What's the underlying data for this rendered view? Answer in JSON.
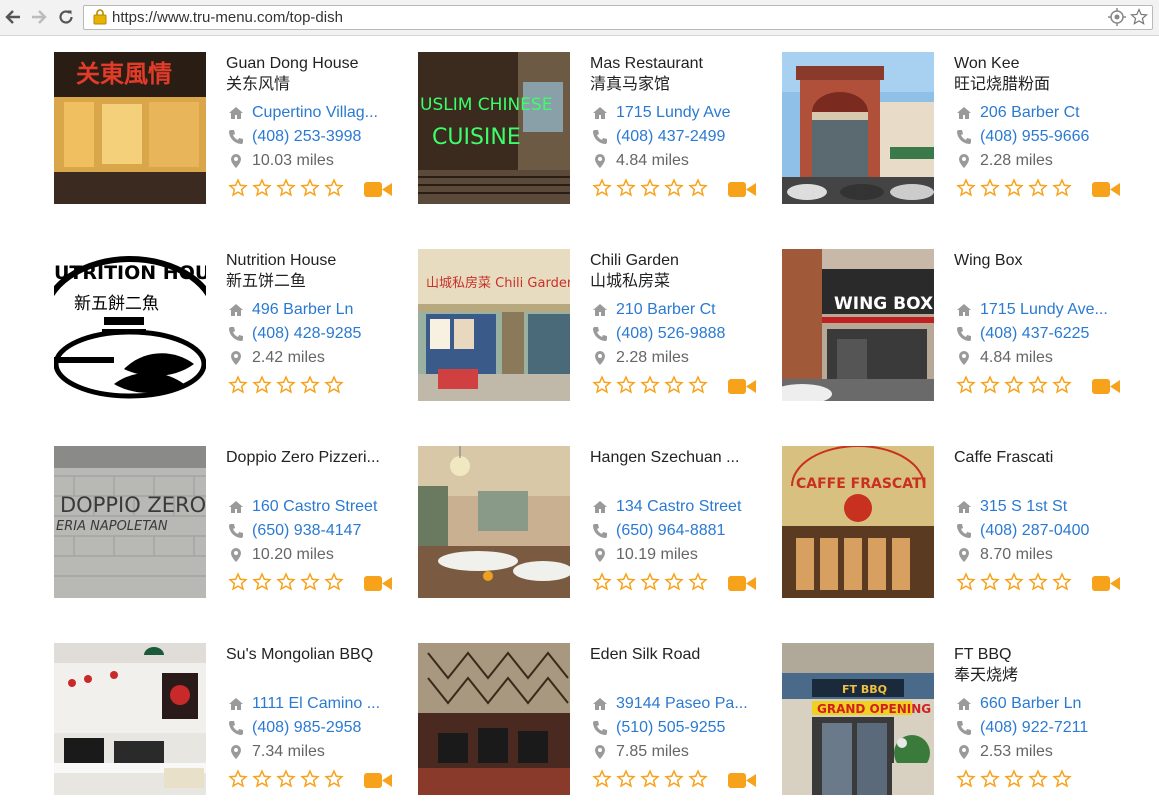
{
  "browser": {
    "url": "https://www.tru-menu.com/top-dish"
  },
  "colors": {
    "link": "#2a7ad2",
    "star": "#f7a21b",
    "video": "#f7a21b",
    "icon_gray": "#9a9a9a"
  },
  "icons": {
    "address": "home-icon",
    "phone": "phone-icon",
    "distance": "location-pin-icon",
    "rating": "star-outline-icon",
    "video": "video-camera-icon"
  },
  "restaurants": [
    {
      "name": "Guan Dong House",
      "chinese_name": "关东风情",
      "address": "Cupertino Villag...",
      "phone": "(408) 253-3998",
      "distance": "10.03 miles",
      "has_video": true
    },
    {
      "name": "Mas Restaurant",
      "chinese_name": "清真马家馆",
      "address": "1715 Lundy Ave",
      "phone": "(408) 437-2499",
      "distance": "4.84 miles",
      "has_video": true
    },
    {
      "name": "Won Kee",
      "chinese_name": "旺记烧腊粉面",
      "address": "206 Barber Ct",
      "phone": "(408) 955-9666",
      "distance": "2.28 miles",
      "has_video": true
    },
    {
      "name": "Nutrition House",
      "chinese_name": "新五饼二鱼",
      "address": "496 Barber Ln",
      "phone": "(408) 428-9285",
      "distance": "2.42 miles",
      "has_video": false
    },
    {
      "name": "Chili Garden",
      "chinese_name": "山城私房菜",
      "address": "210 Barber Ct",
      "phone": "(408) 526-9888",
      "distance": "2.28 miles",
      "has_video": true
    },
    {
      "name": "Wing Box",
      "chinese_name": "",
      "address": "1715 Lundy Ave...",
      "phone": "(408) 437-6225",
      "distance": "4.84 miles",
      "has_video": true
    },
    {
      "name": "Doppio Zero Pizzeri...",
      "chinese_name": "",
      "address": "160 Castro Street",
      "phone": "(650) 938-4147",
      "distance": "10.20 miles",
      "has_video": true
    },
    {
      "name": "Hangen Szechuan ...",
      "chinese_name": "",
      "address": "134 Castro Street",
      "phone": "(650) 964-8881",
      "distance": "10.19 miles",
      "has_video": true
    },
    {
      "name": "Caffe Frascati",
      "chinese_name": "",
      "address": "315 S 1st St",
      "phone": "(408) 287-0400",
      "distance": "8.70 miles",
      "has_video": true
    },
    {
      "name": "Su's Mongolian BBQ",
      "chinese_name": "",
      "address": "1111 El Camino ...",
      "phone": "(408) 985-2958",
      "distance": "7.34 miles",
      "has_video": true
    },
    {
      "name": "Eden Silk Road",
      "chinese_name": "",
      "address": "39144 Paseo Pa...",
      "phone": "(510) 505-9255",
      "distance": "7.85 miles",
      "has_video": true
    },
    {
      "name": "FT BBQ",
      "chinese_name": "奉天烧烤",
      "address": "660 Barber Ln",
      "phone": "(408) 922-7211",
      "distance": "2.53 miles",
      "has_video": false
    }
  ],
  "photo_signs": {
    "0": "关東風情",
    "1a": "USLIM CHINESE",
    "1b": "CUISINE",
    "3a": "UTRITION HOUS",
    "3b": "新五餅二魚",
    "4": "山城私房菜 Chili Garden",
    "5": "WING BOX",
    "6a": "DOPPIO ZERO",
    "6b": "ERIA NAPOLETAN",
    "8": "CAFFE FRASCATI",
    "11a": "FT BBQ",
    "11b": "GRAND OPENING"
  }
}
